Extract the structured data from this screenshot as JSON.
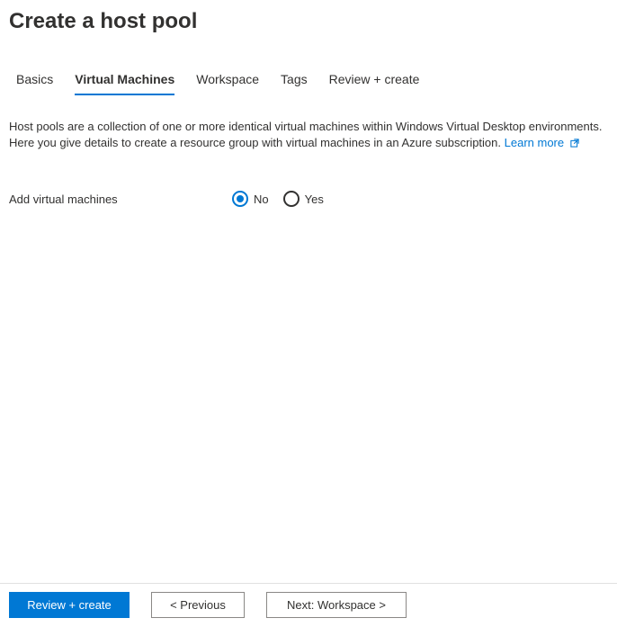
{
  "header": {
    "title": "Create a host pool"
  },
  "tabs": {
    "items": [
      {
        "label": "Basics",
        "active": false
      },
      {
        "label": "Virtual Machines",
        "active": true
      },
      {
        "label": "Workspace",
        "active": false
      },
      {
        "label": "Tags",
        "active": false
      },
      {
        "label": "Review + create",
        "active": false
      }
    ]
  },
  "description": {
    "text": "Host pools are a collection of one or more identical virtual machines within Windows Virtual Desktop environments. Here you give details to create a resource group with virtual machines in an Azure subscription.",
    "learn_more": "Learn more"
  },
  "form": {
    "add_vm_label": "Add virtual machines",
    "radio_no": "No",
    "radio_yes": "Yes",
    "selected": "no"
  },
  "footer": {
    "review_create": "Review + create",
    "previous": "< Previous",
    "next": "Next: Workspace >"
  }
}
